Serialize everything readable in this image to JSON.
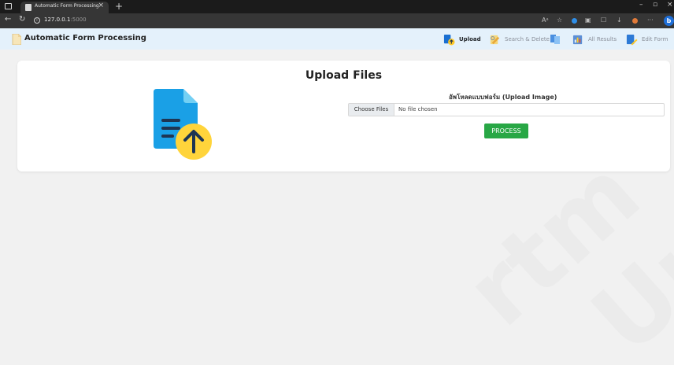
{
  "browser": {
    "tab_title": "Automatic Form Processing",
    "tab_close": "×",
    "new_tab": "+",
    "url_host": "127.0.0.1",
    "url_port": ":5000",
    "window_controls": {
      "minimize": "–",
      "maximize": "▫",
      "close": "×"
    },
    "nav": {
      "back": "←",
      "reload": "↻"
    }
  },
  "navbar": {
    "brand": "Automatic Form Processing",
    "items": [
      {
        "label": "Upload",
        "icon": "upload-document-icon",
        "active": true
      },
      {
        "label": "Search & Delete",
        "icon": "search-pencil-icon",
        "active": false
      },
      {
        "label": "All Results",
        "icon": "results-chart-icon",
        "active": false
      },
      {
        "label": "Edit Form",
        "icon": "edit-form-icon",
        "active": false
      }
    ]
  },
  "card": {
    "title": "Upload Files",
    "upload_label": "อัพโหลดแบบฟอร์ม (Upload Image)",
    "choose_button": "Choose Files",
    "file_status": "No file chosen",
    "process_button": "PROCESS"
  },
  "colors": {
    "navbar_bg": "#e4f1fb",
    "process_button": "#28a745",
    "upload_doc_blue": "#1aa0e6",
    "upload_arrow_yellow": "#ffd43b"
  }
}
